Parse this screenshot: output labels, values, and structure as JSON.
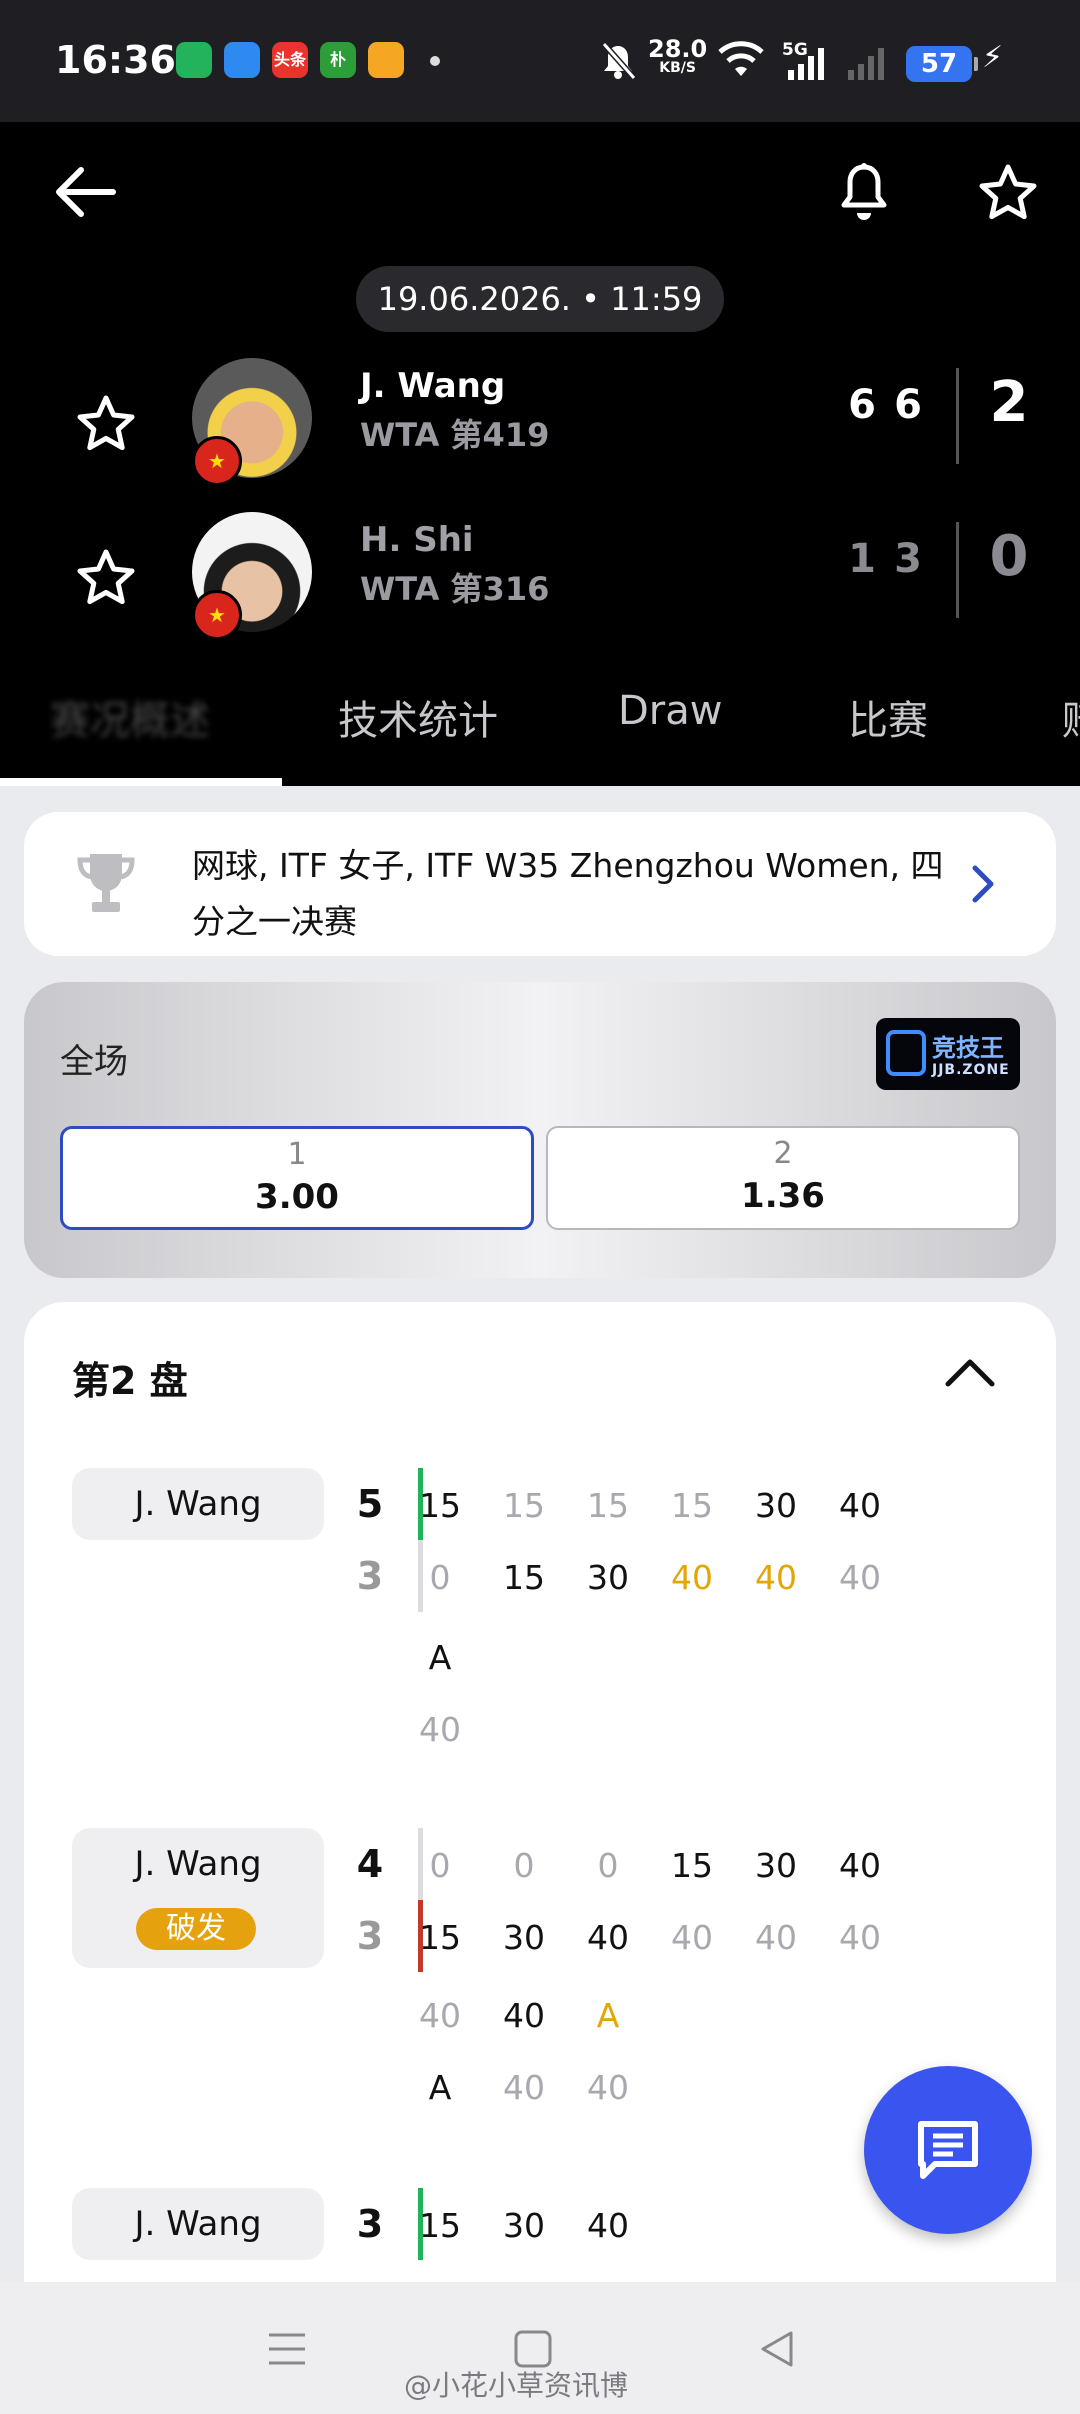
{
  "status": {
    "time": "16:36",
    "speed": "28.0",
    "speed_unit": "KB/S",
    "network": "5G",
    "battery": "57",
    "apps": [
      {
        "name": "battery-app-icon",
        "label": "",
        "color": "#22b35c"
      },
      {
        "name": "browser-app-icon",
        "label": "",
        "color": "#2e8af0"
      },
      {
        "name": "toutiao-app-icon",
        "label": "头条",
        "color": "#e8342c"
      },
      {
        "name": "news-app-icon",
        "label": "朴",
        "color": "#2d9d3a"
      },
      {
        "name": "weibo-app-icon",
        "label": "",
        "color": "#f5a623"
      }
    ]
  },
  "header": {
    "date": "19.06.2026. • 11:59",
    "players": [
      {
        "name": "J. Wang",
        "rank": "WTA 第419",
        "sets": [
          "6",
          "6"
        ],
        "total": "2",
        "winner": true
      },
      {
        "name": "H. Shi",
        "rank": "WTA 第316",
        "sets": [
          "1",
          "3"
        ],
        "total": "0",
        "winner": false
      }
    ],
    "tabs": [
      "赛况概述",
      "技术统计",
      "Draw",
      "比赛",
      "赔"
    ]
  },
  "tournament": {
    "title": "网球, ITF 女子, ITF W35 Zhengzhou Women, 四分之一决赛"
  },
  "odds": {
    "label": "全场",
    "bookmaker": {
      "name": "竞技王",
      "sub": "JJB.ZONE"
    },
    "options": [
      {
        "n": "1",
        "v": "3.00",
        "selected": true
      },
      {
        "n": "2",
        "v": "1.36",
        "selected": false
      }
    ]
  },
  "set": {
    "title": "第2 盘",
    "games": [
      {
        "server": "J. Wang",
        "badge": "",
        "score_top": "5",
        "score_bottom": "3",
        "bar_color": "#1fb35a",
        "bar_row": "top",
        "top": [
          [
            "15",
            "d"
          ],
          [
            "15",
            "l"
          ],
          [
            "15",
            "l"
          ],
          [
            "15",
            "l"
          ],
          [
            "30",
            "d"
          ],
          [
            "40",
            "d"
          ]
        ],
        "bottom": [
          [
            "0",
            "l"
          ],
          [
            "15",
            "d"
          ],
          [
            "30",
            "d"
          ],
          [
            "40",
            "y"
          ],
          [
            "40",
            "y"
          ],
          [
            "40",
            "l"
          ]
        ],
        "extra_top": [
          [
            "A",
            "d"
          ]
        ],
        "extra_bottom": [
          [
            "40",
            "l"
          ]
        ]
      },
      {
        "server": "J. Wang",
        "badge": "破发",
        "score_top": "4",
        "score_bottom": "3",
        "bar_color": "#c0392b",
        "bar_row": "bottom",
        "top": [
          [
            "0",
            "l"
          ],
          [
            "0",
            "l"
          ],
          [
            "0",
            "l"
          ],
          [
            "15",
            "d"
          ],
          [
            "30",
            "d"
          ],
          [
            "40",
            "d"
          ]
        ],
        "bottom": [
          [
            "15",
            "d"
          ],
          [
            "30",
            "d"
          ],
          [
            "40",
            "d"
          ],
          [
            "40",
            "l"
          ],
          [
            "40",
            "l"
          ],
          [
            "40",
            "l"
          ]
        ],
        "extra_top": [
          [
            "40",
            "l"
          ],
          [
            "40",
            "d"
          ],
          [
            "A",
            "y"
          ]
        ],
        "extra_bottom": [
          [
            "A",
            "d"
          ],
          [
            "40",
            "l"
          ],
          [
            "40",
            "l"
          ]
        ]
      },
      {
        "server": "J. Wang",
        "badge": "",
        "score_top": "3",
        "score_bottom": "",
        "bar_color": "#1fb35a",
        "bar_row": "top",
        "top": [
          [
            "15",
            "d"
          ],
          [
            "30",
            "d"
          ],
          [
            "40",
            "d"
          ]
        ],
        "bottom": [],
        "extra_top": [],
        "extra_bottom": []
      }
    ]
  },
  "watermark": "@小花小草资讯博"
}
